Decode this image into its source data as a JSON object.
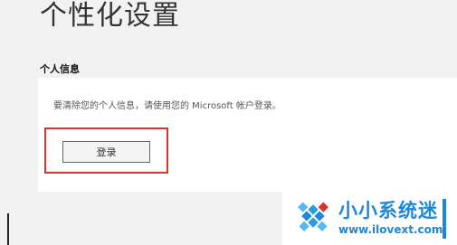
{
  "page": {
    "title": "个性化设置"
  },
  "personal_info": {
    "heading": "个人信息",
    "description": "要清除您的个人信息，请使用您的 Microsoft 帐户登录。",
    "login_label": "登录"
  },
  "watermark": {
    "name": "小小系统迷",
    "url": "www.ilovext.com",
    "accent_color": "#1e87d8",
    "highlight_color": "#d9342b"
  }
}
